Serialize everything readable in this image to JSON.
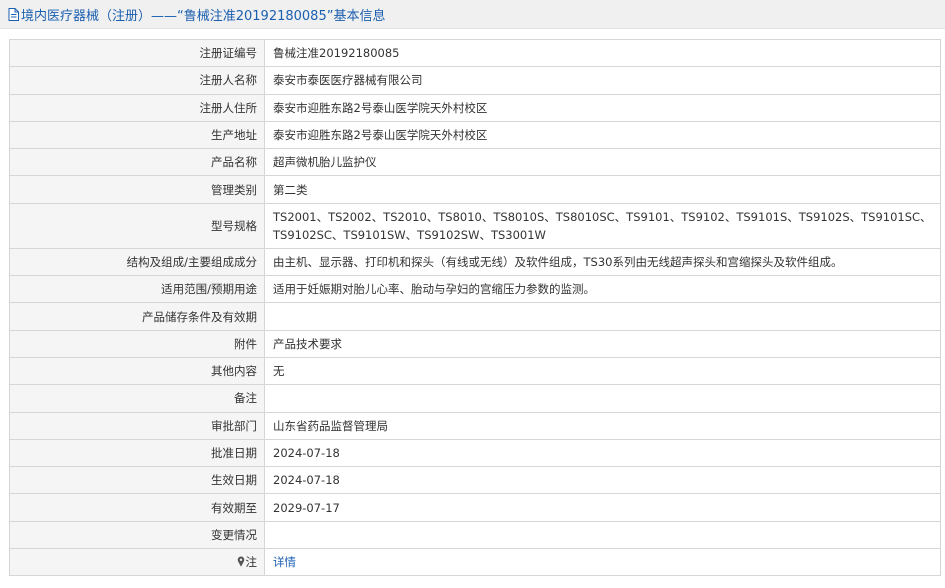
{
  "header": {
    "title": "境内医疗器械（注册）——“鲁械注准20192180085”基本信息",
    "icon": "document-icon"
  },
  "rows": [
    {
      "label": "注册证编号",
      "value": "鲁械注准20192180085"
    },
    {
      "label": "注册人名称",
      "value": "泰安市泰医医疗器械有限公司"
    },
    {
      "label": "注册人住所",
      "value": "泰安市迎胜东路2号泰山医学院天外村校区"
    },
    {
      "label": "生产地址",
      "value": "泰安市迎胜东路2号泰山医学院天外村校区"
    },
    {
      "label": "产品名称",
      "value": "超声微机胎儿监护仪"
    },
    {
      "label": "管理类别",
      "value": "第二类"
    },
    {
      "label": "型号规格",
      "value": "TS2001、TS2002、TS2010、TS8010、TS8010S、TS8010SC、TS9101、TS9102、TS9101S、TS9102S、TS9101SC、TS9102SC、TS9101SW、TS9102SW、TS3001W"
    },
    {
      "label": "结构及组成/主要组成成分",
      "value": "由主机、显示器、打印机和探头（有线或无线）及软件组成，TS30系列由无线超声探头和宫缩探头及软件组成。"
    },
    {
      "label": "适用范围/预期用途",
      "value": "适用于妊娠期对胎儿心率、胎动与孕妇的宫缩压力参数的监测。"
    },
    {
      "label": "产品储存条件及有效期",
      "value": ""
    },
    {
      "label": "附件",
      "value": "产品技术要求"
    },
    {
      "label": "其他内容",
      "value": "无"
    },
    {
      "label": "备注",
      "value": ""
    },
    {
      "label": "审批部门",
      "value": "山东省药品监督管理局"
    },
    {
      "label": "批准日期",
      "value": "2024-07-18"
    },
    {
      "label": "生效日期",
      "value": "2024-07-18"
    },
    {
      "label": "有效期至",
      "value": "2029-07-17"
    },
    {
      "label": "变更情况",
      "value": ""
    },
    {
      "label": "注",
      "value": "详情",
      "icon": "pin-icon"
    }
  ],
  "colors": {
    "link": "#1b5fb0",
    "label_bg": "#f5f5f5",
    "border": "#d6d6d6"
  }
}
